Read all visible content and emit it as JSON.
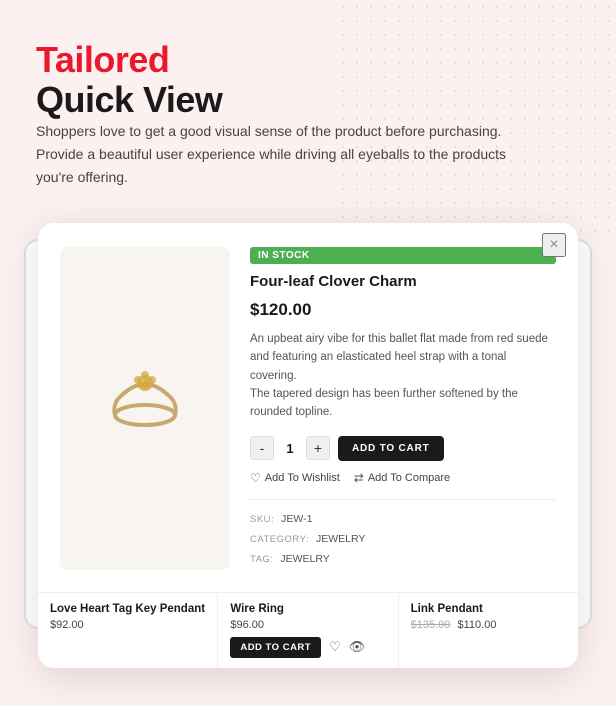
{
  "background_color": "#fdf0f0",
  "heading": {
    "tailored": "Tailored",
    "quick_view": "Quick View"
  },
  "description": "Shoppers love to get a good visual sense of the product before purchasing. Provide a beautiful user experience while driving all eyeballs to the products you're offering.",
  "modal": {
    "close_label": "×",
    "badge": "IN STOCK",
    "product_name": "Four-leaf Clover Charm",
    "price": "$120.00",
    "product_description": "An upbeat airy vibe for this ballet flat made from red suede and featuring an elasticated heel strap with a tonal covering.\nThe tapered design has been further softened by the rounded topline.",
    "qty": "1",
    "qty_minus": "-",
    "qty_plus": "+",
    "add_to_cart": "ADD TO CART",
    "wishlist": "Add To Wishlist",
    "compare": "Add To Compare",
    "sku_label": "SKU:",
    "sku_value": "JEW-1",
    "category_label": "CATEGORY:",
    "category_value": "JEWELRY",
    "tag_label": "TAG:",
    "tag_value": "JEWELRY"
  },
  "strip": {
    "items": [
      {
        "name": "Love Heart Tag Key Pendant",
        "price": "$92.00",
        "has_add_to_cart": false
      },
      {
        "name": "Wire Ring",
        "price": "$96.00",
        "add_to_cart_label": "ADD TO CART",
        "has_add_to_cart": true
      },
      {
        "name": "Link Pendant",
        "original_price": "$135.00",
        "sale_price": "$110.00",
        "has_add_to_cart": false
      }
    ]
  }
}
